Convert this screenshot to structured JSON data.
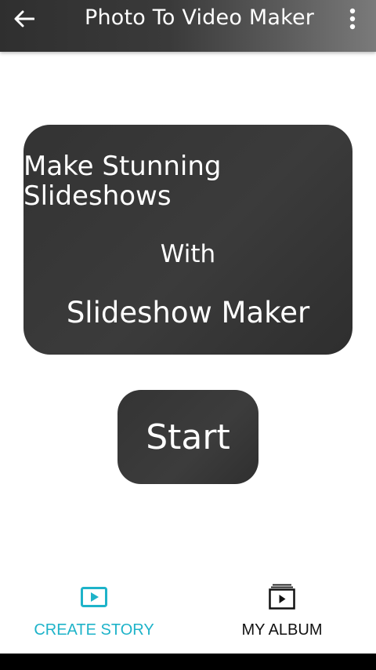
{
  "toolbar": {
    "title": "Photo To Video Maker",
    "back_icon": "arrow-left-icon",
    "menu_icon": "more-vertical-icon"
  },
  "banner": {
    "line1": "Make Stunning Slideshows",
    "line2": "With",
    "line3": "Slideshow Maker"
  },
  "start_button": {
    "label": "Start"
  },
  "bottom_nav": {
    "items": [
      {
        "label": "CREATE STORY",
        "icon": "play-video-icon",
        "active": true,
        "color": "#1eb3c9"
      },
      {
        "label": "MY ALBUM",
        "icon": "album-stack-icon",
        "active": false,
        "color": "#111111"
      }
    ]
  },
  "colors": {
    "toolbar_start": "#2f2f2f",
    "toolbar_end": "#7a7a7a",
    "card": "#363636",
    "accent": "#1eb3c9"
  }
}
